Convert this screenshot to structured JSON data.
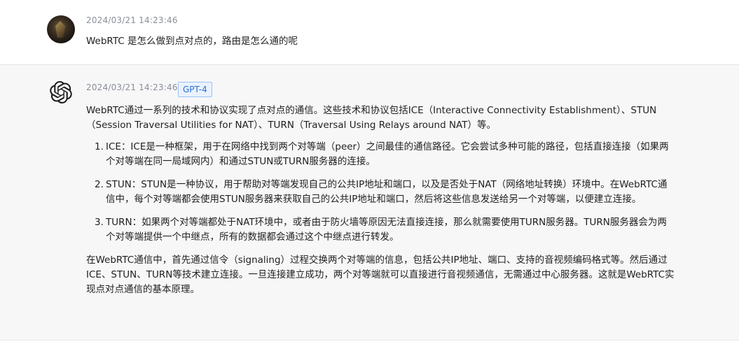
{
  "user_message": {
    "timestamp": "2024/03/21 14:23:46",
    "text": "WebRTC 是怎么做到点对点的，路由是怎么通的呢"
  },
  "assistant_message": {
    "timestamp": "2024/03/21 14:23:46",
    "model_badge": "GPT-4",
    "intro": "WebRTC通过一系列的技术和协议实现了点对点的通信。这些技术和协议包括ICE（Interactive Connectivity Establishment）、STUN（Session Traversal Utilities for NAT）、TURN（Traversal Using Relays around NAT）等。",
    "items": [
      {
        "num": "1.",
        "text": "ICE：ICE是一种框架，用于在网络中找到两个对等端（peer）之间最佳的通信路径。它会尝试多种可能的路径，包括直接连接（如果两个对等端在同一局域网内）和通过STUN或TURN服务器的连接。"
      },
      {
        "num": "2.",
        "text": "STUN：STUN是一种协议，用于帮助对等端发现自己的公共IP地址和端口，以及是否处于NAT（网络地址转换）环境中。在WebRTC通信中，每个对等端都会使用STUN服务器来获取自己的公共IP地址和端口，然后将这些信息发送给另一个对等端，以便建立连接。"
      },
      {
        "num": "3.",
        "text": "TURN：如果两个对等端都处于NAT环境中，或者由于防火墙等原因无法直接连接，那么就需要使用TURN服务器。TURN服务器会为两个对等端提供一个中继点，所有的数据都会通过这个中继点进行转发。"
      }
    ],
    "closing": "在WebRTC通信中，首先通过信令（signaling）过程交换两个对等端的信息，包括公共IP地址、端口、支持的音视频编码格式等。然后通过ICE、STUN、TURN等技术建立连接。一旦连接建立成功，两个对等端就可以直接进行音视频通信，无需通过中心服务器。这就是WebRTC实现点对点通信的基本原理。"
  },
  "colors": {
    "badge_text": "#2b6fd6",
    "badge_bg": "#eaf2ff",
    "assistant_bg": "#f7f7f8",
    "timestamp": "#8a8f98"
  },
  "icons": {
    "user_avatar": "user-avatar",
    "assistant_avatar": "openai-logo-icon"
  }
}
